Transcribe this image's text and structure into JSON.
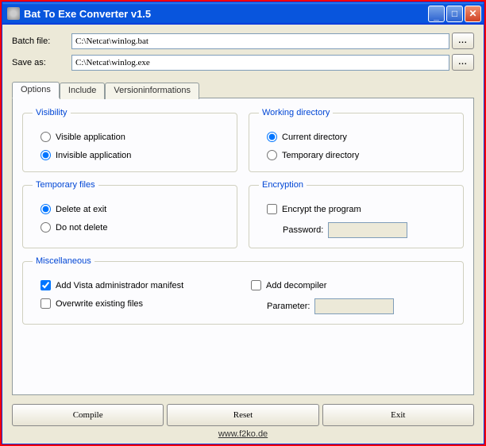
{
  "window": {
    "title": "Bat To Exe Converter v1.5"
  },
  "files": {
    "batch_label": "Batch file:",
    "batch_value": "C:\\Netcat\\winlog.bat",
    "save_label": "Save as:",
    "save_value": "C:\\Netcat\\winlog.exe",
    "browse": "..."
  },
  "tabs": {
    "options": "Options",
    "include": "Include",
    "version": "Versioninformations"
  },
  "visibility": {
    "legend": "Visibility",
    "visible": "Visible application",
    "invisible": "Invisible application",
    "selected": "invisible"
  },
  "working": {
    "legend": "Working directory",
    "current": "Current directory",
    "temp": "Temporary directory",
    "selected": "current"
  },
  "tempfiles": {
    "legend": "Temporary files",
    "delete": "Delete at exit",
    "keep": "Do not delete",
    "selected": "delete"
  },
  "encryption": {
    "legend": "Encryption",
    "encrypt": "Encrypt the program",
    "password_label": "Password:",
    "password_value": ""
  },
  "misc": {
    "legend": "Miscellaneous",
    "vista": "Add Vista administrador manifest",
    "vista_checked": true,
    "overwrite": "Overwrite existing files",
    "decompiler": "Add decompiler",
    "param_label": "Parameter:",
    "param_value": ""
  },
  "buttons": {
    "compile": "Compile",
    "reset": "Reset",
    "exit": "Exit"
  },
  "footer": {
    "link": "www.f2ko.de"
  }
}
